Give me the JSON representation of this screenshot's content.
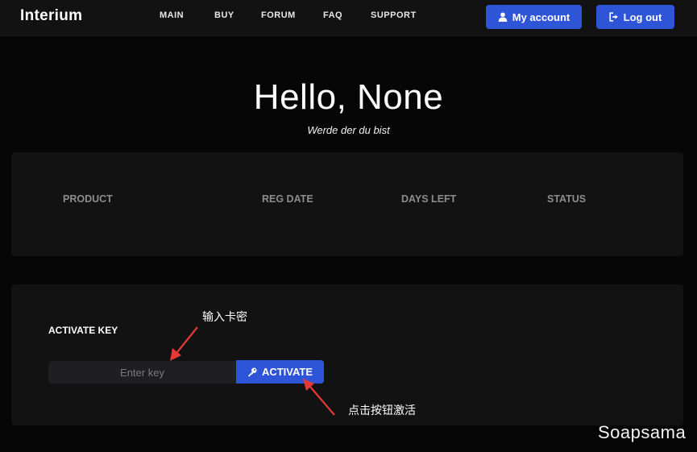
{
  "brand": "Interium",
  "nav": {
    "main": "MAIN",
    "buy": "BUY",
    "forum": "FORUM",
    "faq": "FAQ",
    "support": "SUPPORT"
  },
  "header_buttons": {
    "account": {
      "label": "My account",
      "icon": "user-icon"
    },
    "logout": {
      "label": "Log out",
      "icon": "sign-out-icon"
    }
  },
  "hero": {
    "title": "Hello, None",
    "subtitle": "Werde der du bist"
  },
  "products_table": {
    "columns": [
      "PRODUCT",
      "REG DATE",
      "DAYS LEFT",
      "STATUS"
    ],
    "rows": []
  },
  "activation": {
    "label": "ACTIVATE KEY",
    "input_placeholder": "Enter key",
    "input_value": "",
    "button_label": "ACTIVATE",
    "button_icon": "key-icon"
  },
  "annotations": {
    "input_note": "输入卡密",
    "button_note": "点击按钮激活",
    "arrow_color": "#e53935"
  },
  "watermark": "Soapsama",
  "colors": {
    "accent": "#2e55d8",
    "background": "#060606",
    "panel": "#121212",
    "header_text_muted": "#8d8d8d"
  }
}
